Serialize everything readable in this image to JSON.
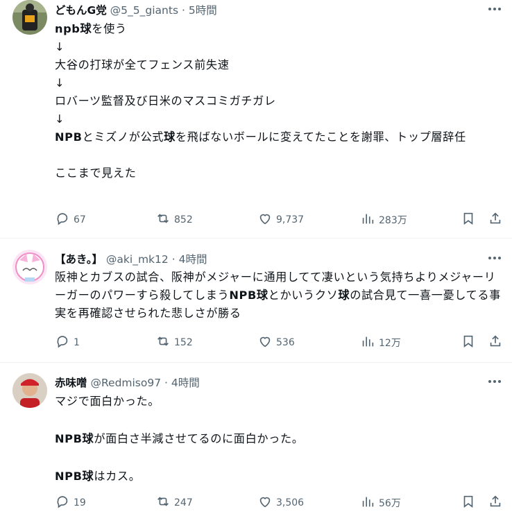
{
  "tweets": [
    {
      "name": "どもんG党",
      "handle": "@5_5_giants",
      "dot": "·",
      "time": "5時間",
      "lines": [
        [
          {
            "t": "npb球",
            "b": true
          },
          {
            "t": "を使う"
          }
        ],
        [
          {
            "t": "↓"
          }
        ],
        [
          {
            "t": "大谷の打球が全てフェンス前失速"
          }
        ],
        [
          {
            "t": "↓"
          }
        ],
        [
          {
            "t": "ロバーツ監督及び日米のマスコミガチガレ"
          }
        ],
        [
          {
            "t": "↓"
          }
        ],
        [
          {
            "t": "NPB",
            "b": true
          },
          {
            "t": "とミズノが公式"
          },
          {
            "t": "球",
            "b": true
          },
          {
            "t": "を飛ばないボールに変えてたことを謝罪、トップ層辞任"
          }
        ],
        [],
        [
          {
            "t": "ここまで見えた"
          }
        ]
      ],
      "replies": "67",
      "retweets": "852",
      "likes": "9,737",
      "views": "283万"
    },
    {
      "name": "【あき。】",
      "handle": "@aki_mk12",
      "dot": "·",
      "time": "4時間",
      "lines": [
        [
          {
            "t": "阪神とカブスの試合、阪神がメジャーに通用してて凄いという気持ちよりメジャーリーガーのパワーすら殺してしまう"
          },
          {
            "t": "NPB球",
            "b": true
          },
          {
            "t": "とかいうクソ"
          },
          {
            "t": "球",
            "b": true
          },
          {
            "t": "の試合見て一喜一憂してる事実を再確認させられた悲しさが勝る"
          }
        ]
      ],
      "replies": "1",
      "retweets": "152",
      "likes": "536",
      "views": "12万"
    },
    {
      "name": "赤味噌",
      "handle": "@Redmiso97",
      "dot": "·",
      "time": "4時間",
      "lines": [
        [
          {
            "t": "マジで面白かった。"
          }
        ],
        [],
        [
          {
            "t": "NPB球",
            "b": true
          },
          {
            "t": "が面白さ半減させてるのに面白かった。"
          }
        ],
        [],
        [
          {
            "t": "NPB球",
            "b": true
          },
          {
            "t": "はカス。"
          }
        ]
      ],
      "replies": "19",
      "retweets": "247",
      "likes": "3,506",
      "views": "56万"
    }
  ],
  "icons": {
    "more": "more-icon",
    "reply": "reply-icon",
    "retweet": "retweet-icon",
    "like": "like-icon",
    "views": "views-icon",
    "bookmark": "bookmark-icon",
    "share": "share-icon"
  },
  "colors": {
    "text": "#0f1419",
    "secondary": "#536471",
    "divider": "#eff3f4"
  }
}
